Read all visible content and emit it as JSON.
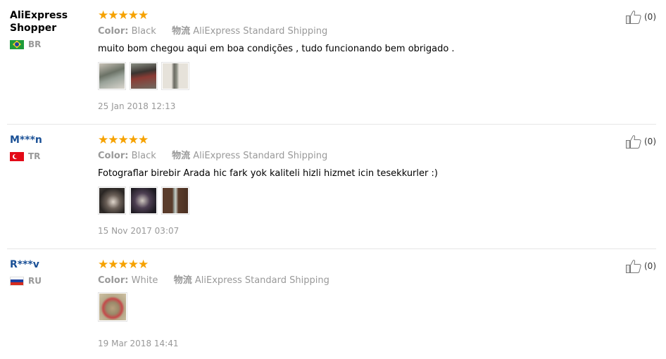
{
  "reviews": [
    {
      "user": "AliExpress Shopper",
      "country_code": "BR",
      "stars": "★★★★★",
      "color_label": "Color:",
      "color_value": "Black",
      "shipping_label": "物流",
      "shipping_value": "AliExpress Standard Shipping",
      "feedback": "muito bom chegou aqui em boa condições , tudo funcionando bem obrigado .",
      "date": "25 Jan 2018 12:13",
      "helpful_count": "(0)",
      "photo_count": 3
    },
    {
      "user": "M***n",
      "country_code": "TR",
      "stars": "★★★★★",
      "color_label": "Color:",
      "color_value": "Black",
      "shipping_label": "物流",
      "shipping_value": "AliExpress Standard Shipping",
      "feedback": "Fotograflar birebir Arada hic fark yok kaliteli hizli hizmet icin tesekkurler :)",
      "date": "15 Nov 2017 03:07",
      "helpful_count": "(0)",
      "photo_count": 3
    },
    {
      "user": "R***v",
      "country_code": "RU",
      "stars": "★★★★★",
      "color_label": "Color:",
      "color_value": "White",
      "shipping_label": "物流",
      "shipping_value": "AliExpress Standard Shipping",
      "feedback": "",
      "date": "19 Mar 2018 14:41",
      "helpful_count": "(0)",
      "photo_count": 1
    }
  ],
  "colors": {
    "star": "#f6a200",
    "username_link": "#1a5096",
    "muted": "#999999",
    "separator": "#e6e6e6"
  },
  "icons": {
    "helpful": "thumbs-up-icon",
    "star": "star-icon"
  }
}
